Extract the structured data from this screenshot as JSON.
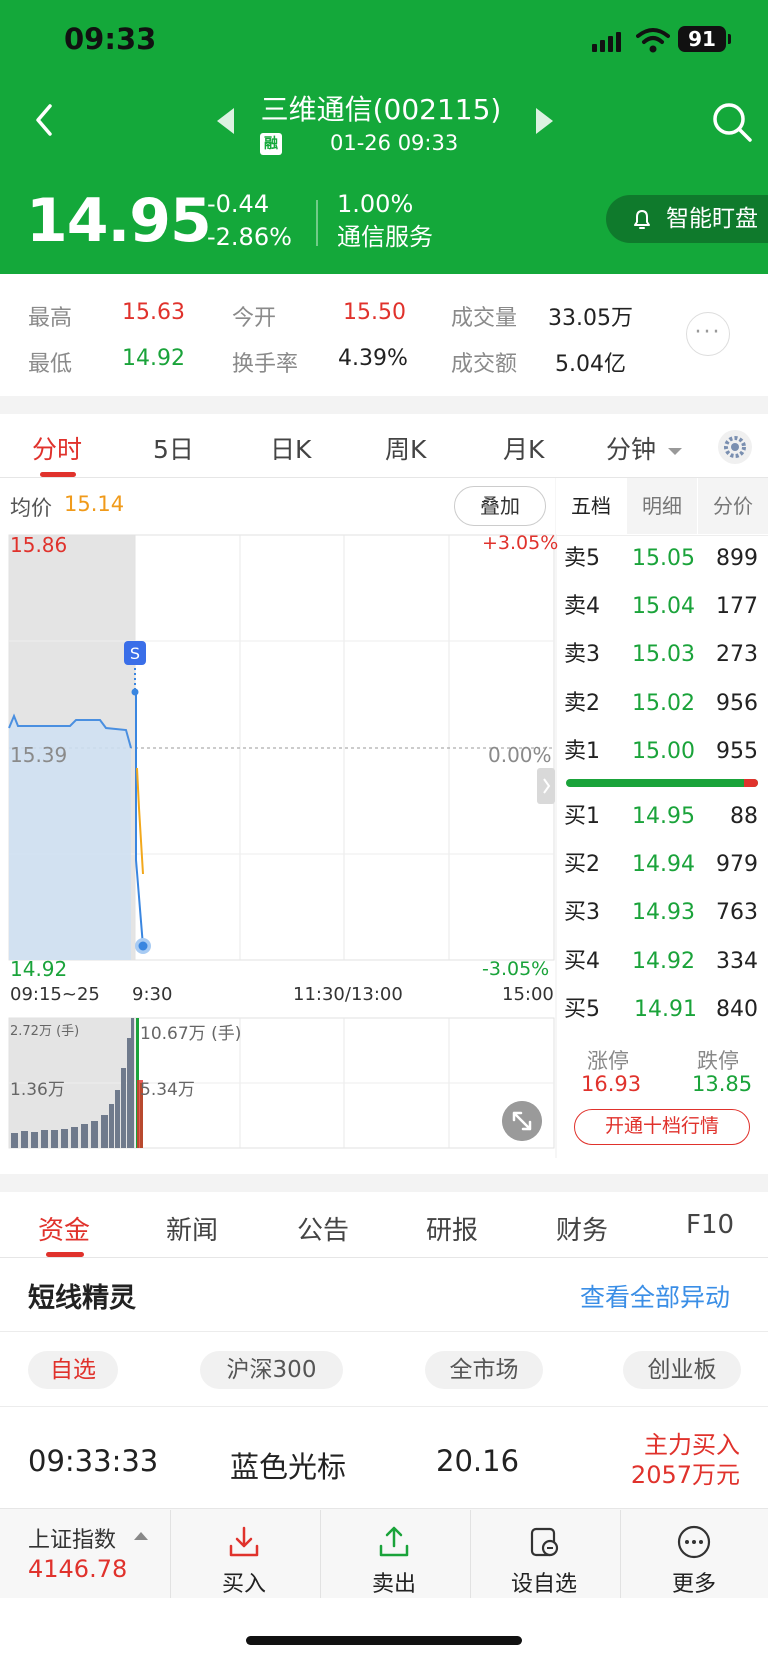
{
  "status_bar": {
    "time": "09:33",
    "battery": "91"
  },
  "header": {
    "stock_name": "三维通信(002115)",
    "margin_badge": "融",
    "datetime": "01-26 09:33",
    "price": "14.95",
    "change": "-0.44",
    "change_pct": "-2.86%",
    "turnover_small": "1.00%",
    "sector": "通信服务",
    "watch_label": "智能盯盘"
  },
  "stats": {
    "high_label": "最高",
    "high": "15.63",
    "open_label": "今开",
    "open": "15.50",
    "volume_label": "成交量",
    "volume": "33.05万",
    "low_label": "最低",
    "low": "14.92",
    "turnover_label": "换手率",
    "turnover": "4.39%",
    "amount_label": "成交额",
    "amount": "5.04亿"
  },
  "chart_tabs": [
    "分时",
    "5日",
    "日K",
    "周K",
    "月K",
    "分钟"
  ],
  "intraday": {
    "avg_label": "均价",
    "avg_value": "15.14",
    "overlay_button": "叠加",
    "y_top": "15.86",
    "y_mid": "15.39",
    "y_bottom": "14.92",
    "pct_top": "+3.05%",
    "pct_mid": "0.00%",
    "pct_bottom": "-3.05%",
    "x_labels": [
      "09:15~25",
      "9:30",
      "11:30/13:00",
      "15:00"
    ],
    "marker": "S",
    "vol_left_top": "2.72万 (手)",
    "vol_left_mid": "1.36万",
    "vol_right_top": "10.67万 (手)",
    "vol_right_mid": "5.34万"
  },
  "order_book": {
    "tabs": [
      "五档",
      "明细",
      "分价"
    ],
    "sells": [
      {
        "label": "卖5",
        "price": "15.05",
        "qty": "899"
      },
      {
        "label": "卖4",
        "price": "15.04",
        "qty": "177"
      },
      {
        "label": "卖3",
        "price": "15.03",
        "qty": "273"
      },
      {
        "label": "卖2",
        "price": "15.02",
        "qty": "956"
      },
      {
        "label": "卖1",
        "price": "15.00",
        "qty": "955"
      }
    ],
    "buys": [
      {
        "label": "买1",
        "price": "14.95",
        "qty": "88"
      },
      {
        "label": "买2",
        "price": "14.94",
        "qty": "979"
      },
      {
        "label": "买3",
        "price": "14.93",
        "qty": "763"
      },
      {
        "label": "买4",
        "price": "14.92",
        "qty": "334"
      },
      {
        "label": "买5",
        "price": "14.91",
        "qty": "840"
      }
    ],
    "limit_up_label": "涨停",
    "limit_up": "16.93",
    "limit_down_label": "跌停",
    "limit_down": "13.85",
    "ten_level_button": "开通十档行情"
  },
  "bottom_tabs": [
    "资金",
    "新闻",
    "公告",
    "研报",
    "财务",
    "F10"
  ],
  "section": {
    "title": "短线精灵",
    "link": "查看全部异动",
    "filters": [
      "自选",
      "沪深300",
      "全市场",
      "创业板"
    ],
    "row": {
      "time": "09:33:33",
      "name": "蓝色光标",
      "price": "20.16",
      "action_line1": "主力买入",
      "action_line2": "2057万元"
    }
  },
  "bottom_bar": {
    "index_name": "上证指数",
    "index_value": "4146.78",
    "buttons": [
      "买入",
      "卖出",
      "设自选",
      "更多"
    ]
  }
}
